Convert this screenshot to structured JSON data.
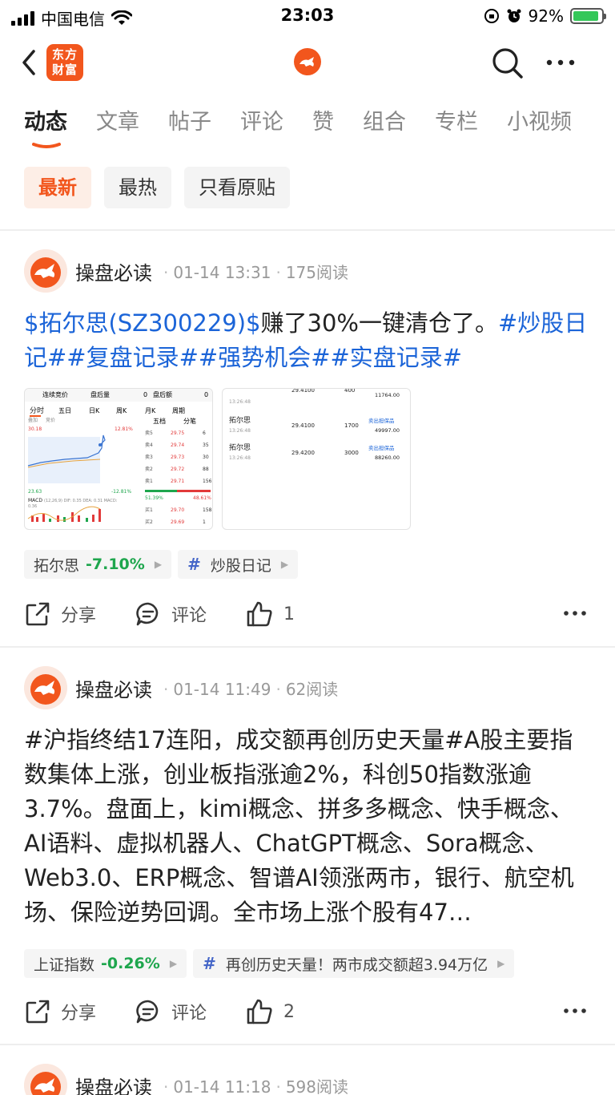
{
  "status_bar": {
    "carrier": "中国电信",
    "time": "23:03",
    "battery": "92%",
    "battery_level": 0.92
  },
  "nav": {
    "brand_logo_text": "东方财富",
    "icons": [
      "back-icon",
      "brand-logo",
      "bull-logo-icon",
      "search-icon",
      "more-icon"
    ]
  },
  "tabs": [
    "动态",
    "文章",
    "帖子",
    "评论",
    "赞",
    "组合",
    "专栏",
    "小视频"
  ],
  "active_tab": "动态",
  "filters": [
    "最新",
    "最热",
    "只看原贴"
  ],
  "active_filter": "最新",
  "posts": [
    {
      "author": "操盘必读",
      "date": "01-14 13:31",
      "reads": "175阅读",
      "text_stock_link": "$拓尔思(SZ300229)$",
      "text_body": "赚了30%一键清仓了。",
      "text_hashtags": "#炒股日记##复盘记录##强势机会##实盘记录#",
      "thumb_left": {
        "header": [
          "连续竞价",
          "盘后量",
          "0",
          "盘后额",
          "0"
        ],
        "tabs": [
          "分时",
          "五日",
          "日K",
          "周K",
          "月K",
          "周期"
        ],
        "high": "30.18",
        "low": "23.63",
        "pct_high": "12.81%",
        "pct_low": "-12.81%",
        "legend": [
          "叠加",
          "竞价"
        ],
        "book_tabs": [
          "五档",
          "分笔"
        ],
        "asks": [
          {
            "label": "卖5",
            "price": "29.75",
            "vol": "6"
          },
          {
            "label": "卖4",
            "price": "29.74",
            "vol": "35"
          },
          {
            "label": "卖3",
            "price": "29.73",
            "vol": "30"
          },
          {
            "label": "卖2",
            "price": "29.72",
            "vol": "88"
          },
          {
            "label": "卖1",
            "price": "29.71",
            "vol": "156"
          }
        ],
        "bids": [
          {
            "label": "买1",
            "price": "29.70",
            "vol": "158"
          },
          {
            "label": "买2",
            "price": "29.69",
            "vol": "1"
          }
        ],
        "buy_pct": "51.39%",
        "sell_pct": "48.61%",
        "macd_label": "MACD",
        "macd_params": "(12,26,9) DIF: 0.35  DEA: 0.31  MACD:",
        "macd_value": "0.36"
      },
      "thumb_right": {
        "rows": [
          {
            "name": "",
            "time": "13:26:48",
            "price": "29.4100",
            "qty": "400",
            "type": "",
            "amount": "11764.00"
          },
          {
            "name": "拓尔思",
            "time": "13:26:48",
            "price": "29.4100",
            "qty": "1700",
            "type": "卖出担保品",
            "amount": "49997.00"
          },
          {
            "name": "拓尔思",
            "time": "13:26:48",
            "price": "29.4200",
            "qty": "3000",
            "type": "卖出担保品",
            "amount": "88260.00"
          }
        ]
      },
      "tags": [
        {
          "label": "拓尔思",
          "change": "-7.10%"
        },
        {
          "label": "炒股日记",
          "hashtag": "#"
        }
      ],
      "actions": {
        "share": "分享",
        "comment": "评论",
        "likes": "1"
      }
    },
    {
      "author": "操盘必读",
      "date": "01-14 11:49",
      "reads": "62阅读",
      "text": "#沪指终结17连阳，成交额再创历史天量#A股主要指数集体上涨，创业板指涨逾2%，科创50指数涨逾3.7%。盘面上，kimi概念、拼多多概念、快手概念、AI语料、虚拟机器人、ChatGPT概念、Sora概念、Web3.0、ERP概念、智谱AI领涨两市，银行、航空机场、保险逆势回调。全市场上涨个股有47…",
      "tags": [
        {
          "label": "上证指数",
          "change": "-0.26%"
        },
        {
          "label": "再创历史天量！两市成交额超3.94万亿",
          "hashtag": "#"
        }
      ],
      "actions": {
        "share": "分享",
        "comment": "评论",
        "likes": "2"
      }
    },
    {
      "author": "操盘必读",
      "date": "01-14 11:18",
      "reads": "598阅读"
    }
  ],
  "colors": {
    "brand": "#f2561d",
    "link": "#1b64d8",
    "down": "#1ea64d",
    "up": "#e23a3a"
  }
}
